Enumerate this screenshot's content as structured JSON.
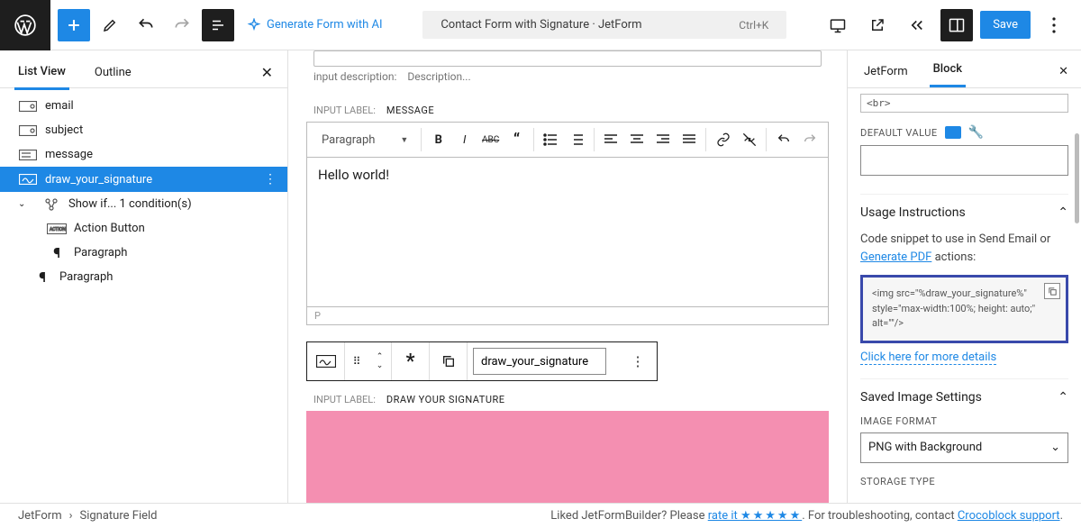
{
  "topbar": {
    "ai_label": "Generate Form with AI",
    "title": "Contact Form with Signature · JetForm",
    "shortcut": "Ctrl+K",
    "save_label": "Save"
  },
  "sidebar_left": {
    "tabs": {
      "list_view": "List View",
      "outline": "Outline"
    },
    "items": [
      {
        "label": "email",
        "indent": 0,
        "icon": "field"
      },
      {
        "label": "subject",
        "indent": 0,
        "icon": "field"
      },
      {
        "label": "message",
        "indent": 0,
        "icon": "field"
      },
      {
        "label": "draw_your_signature",
        "indent": 0,
        "icon": "sig",
        "selected": true
      },
      {
        "label": "Show if... 1 condition(s)",
        "indent": 0,
        "icon": "cond",
        "caret": true
      },
      {
        "label": "Action Button",
        "indent": 2,
        "icon": "action"
      },
      {
        "label": "Paragraph",
        "indent": 2,
        "icon": "para"
      },
      {
        "label": "Paragraph",
        "indent": 1,
        "icon": "para"
      }
    ]
  },
  "canvas": {
    "desc_label": "input description:",
    "desc_value": "Description...",
    "message": {
      "section_prefix": "INPUT LABEL:",
      "section_value": "MESSAGE",
      "paragraph_label": "Paragraph",
      "body_text": "Hello world!",
      "footer_text": "P"
    },
    "floating": {
      "field_value": "draw_your_signature"
    },
    "signature": {
      "section_prefix": "INPUT LABEL:",
      "section_value": "DRAW YOUR SIGNATURE"
    }
  },
  "sidebar_right": {
    "tabs": {
      "jetform": "JetForm",
      "block": "Block"
    },
    "code_mini": "<br>",
    "default_value_label": "DEFAULT VALUE",
    "usage": {
      "title": "Usage Instructions",
      "text_prefix": "Code snippet to use in Send Email or ",
      "link": "Generate PDF",
      "text_suffix": " actions:",
      "code": "<img src=\"%draw_your_signature%\" style=\"max-width:100%; height: auto;\" alt=\"\"/>",
      "more": "Click here for more details"
    },
    "saved": {
      "title": "Saved Image Settings",
      "format_label": "IMAGE FORMAT",
      "format_value": "PNG with Background",
      "storage_label": "STORAGE TYPE"
    }
  },
  "footer": {
    "crumb1": "JetForm",
    "crumb2": "Signature Field",
    "text1": "Liked JetFormBuilder? Please ",
    "rate": "rate it ",
    "stars": "★★★★★",
    "text2": ". For troubleshooting, contact ",
    "support": "Crocoblock support",
    "text3": "."
  }
}
